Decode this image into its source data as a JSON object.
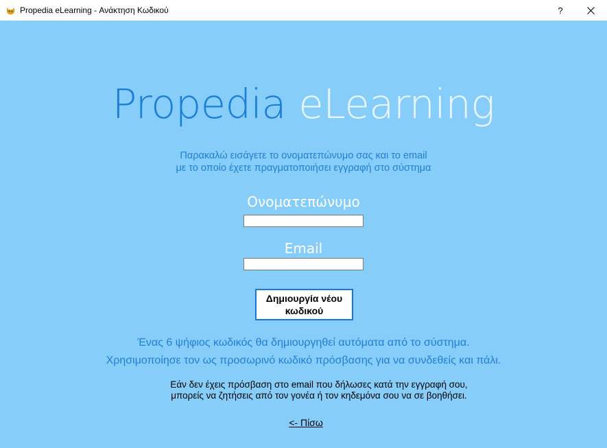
{
  "window": {
    "title": "Propedia eLearning - Ανάκτηση Κωδικού",
    "help_label": "?",
    "close_label": "✕",
    "app_icon": "cat-icon"
  },
  "logo": {
    "part1": "Propedia",
    "part2": "eLearning"
  },
  "instructions": {
    "line1": "Παρακαλώ εισάγετε το ονοματεπώνυμο σας και το email",
    "line2": "με το οποίο έχετε πραγματοποιήσει εγγραφή στο σύστημα"
  },
  "form": {
    "name_label": "Ονοματεπώνυμο",
    "name_value": "",
    "email_label": "Email",
    "email_value": "",
    "submit_line1": "Δημιουργία νέου",
    "submit_line2": "κωδικού"
  },
  "info": {
    "line1": "Ένας 6 ψήφιος κωδικός θα δημιουργηθεί αυτόματα από το σύστημα.",
    "line2": "Χρησιμοποίησε τον ως προσωρινό κωδικό πρόσβασης για να συνδεθείς και πάλι."
  },
  "note": {
    "line1": "Εάν δεν έχεις πρόσβαση στο email που δήλωσες κατά την εγγραφή σου,",
    "line2": "μπορείς να ζητήσεις από τον γονέα ή τον κηδεμόνα σου να σε βοηθήσει."
  },
  "back": {
    "label": "<- Πίσω"
  },
  "colors": {
    "background": "#87cdf9",
    "logo_primary": "#1a7ed8",
    "logo_secondary": "#eaf6ff",
    "accent_text": "#1f7fd6",
    "button_border": "#1678d2"
  }
}
